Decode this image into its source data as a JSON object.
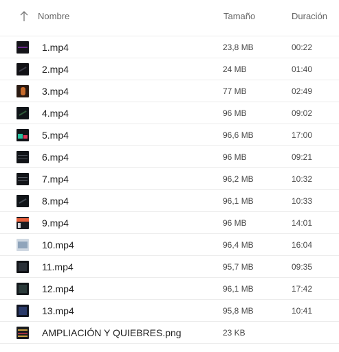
{
  "header": {
    "name_label": "Nombre",
    "size_label": "Tamaño",
    "duration_label": "Duración",
    "sort_icon": "arrow-up-icon"
  },
  "files": [
    {
      "name": "1.mp4",
      "size": "23,8 MB",
      "duration": "00:22",
      "thumb": {
        "bg": "#141419",
        "accent": "#6a2a8a",
        "style": "line"
      }
    },
    {
      "name": "2.mp4",
      "size": "24 MB",
      "duration": "01:40",
      "thumb": {
        "bg": "#121216",
        "accent": "#3a3a46",
        "style": "diag"
      }
    },
    {
      "name": "3.mp4",
      "size": "77 MB",
      "duration": "02:49",
      "thumb": {
        "bg": "#2a1a12",
        "accent": "#c76a2a",
        "style": "figure"
      }
    },
    {
      "name": "4.mp4",
      "size": "96 MB",
      "duration": "09:02",
      "thumb": {
        "bg": "#101418",
        "accent": "#2f5a3a",
        "style": "diag"
      }
    },
    {
      "name": "5.mp4",
      "size": "96,6 MB",
      "duration": "17:00",
      "thumb": {
        "bg": "#111418",
        "accent": "#27c2a0",
        "accent2": "#e0385a",
        "style": "blocks"
      }
    },
    {
      "name": "6.mp4",
      "size": "96 MB",
      "duration": "09:21",
      "thumb": {
        "bg": "#121418",
        "accent": "#4a4f58",
        "style": "lines"
      }
    },
    {
      "name": "7.mp4",
      "size": "96,2 MB",
      "duration": "10:32",
      "thumb": {
        "bg": "#121418",
        "accent": "#5a5f68",
        "style": "lines"
      }
    },
    {
      "name": "8.mp4",
      "size": "96,1 MB",
      "duration": "10:33",
      "thumb": {
        "bg": "#101418",
        "accent": "#3e4650",
        "style": "diag"
      }
    },
    {
      "name": "9.mp4",
      "size": "96 MB",
      "duration": "14:01",
      "thumb": {
        "bg": "#1a1c22",
        "accent": "#e8603c",
        "style": "top"
      }
    },
    {
      "name": "10.mp4",
      "size": "96,4 MB",
      "duration": "16:04",
      "thumb": {
        "bg": "#cfd8e2",
        "accent": "#8fa4bb",
        "style": "light"
      }
    },
    {
      "name": "11.mp4",
      "size": "95,7 MB",
      "duration": "09:35",
      "thumb": {
        "bg": "#121418",
        "accent": "#2a3038",
        "style": "plain"
      }
    },
    {
      "name": "12.mp4",
      "size": "96,1 MB",
      "duration": "17:42",
      "thumb": {
        "bg": "#14181c",
        "accent": "#2a3a3a",
        "style": "plain"
      }
    },
    {
      "name": "13.mp4",
      "size": "95,8 MB",
      "duration": "10:41",
      "thumb": {
        "bg": "#121622",
        "accent": "#2a3a6a",
        "style": "plain"
      }
    },
    {
      "name": "AMPLIACIÓN Y QUIEBRES.png",
      "size": "23 KB",
      "duration": "",
      "thumb": {
        "bg": "#1a1c20",
        "accent": "#c8a040",
        "accent2": "#a03040",
        "style": "png"
      }
    }
  ]
}
